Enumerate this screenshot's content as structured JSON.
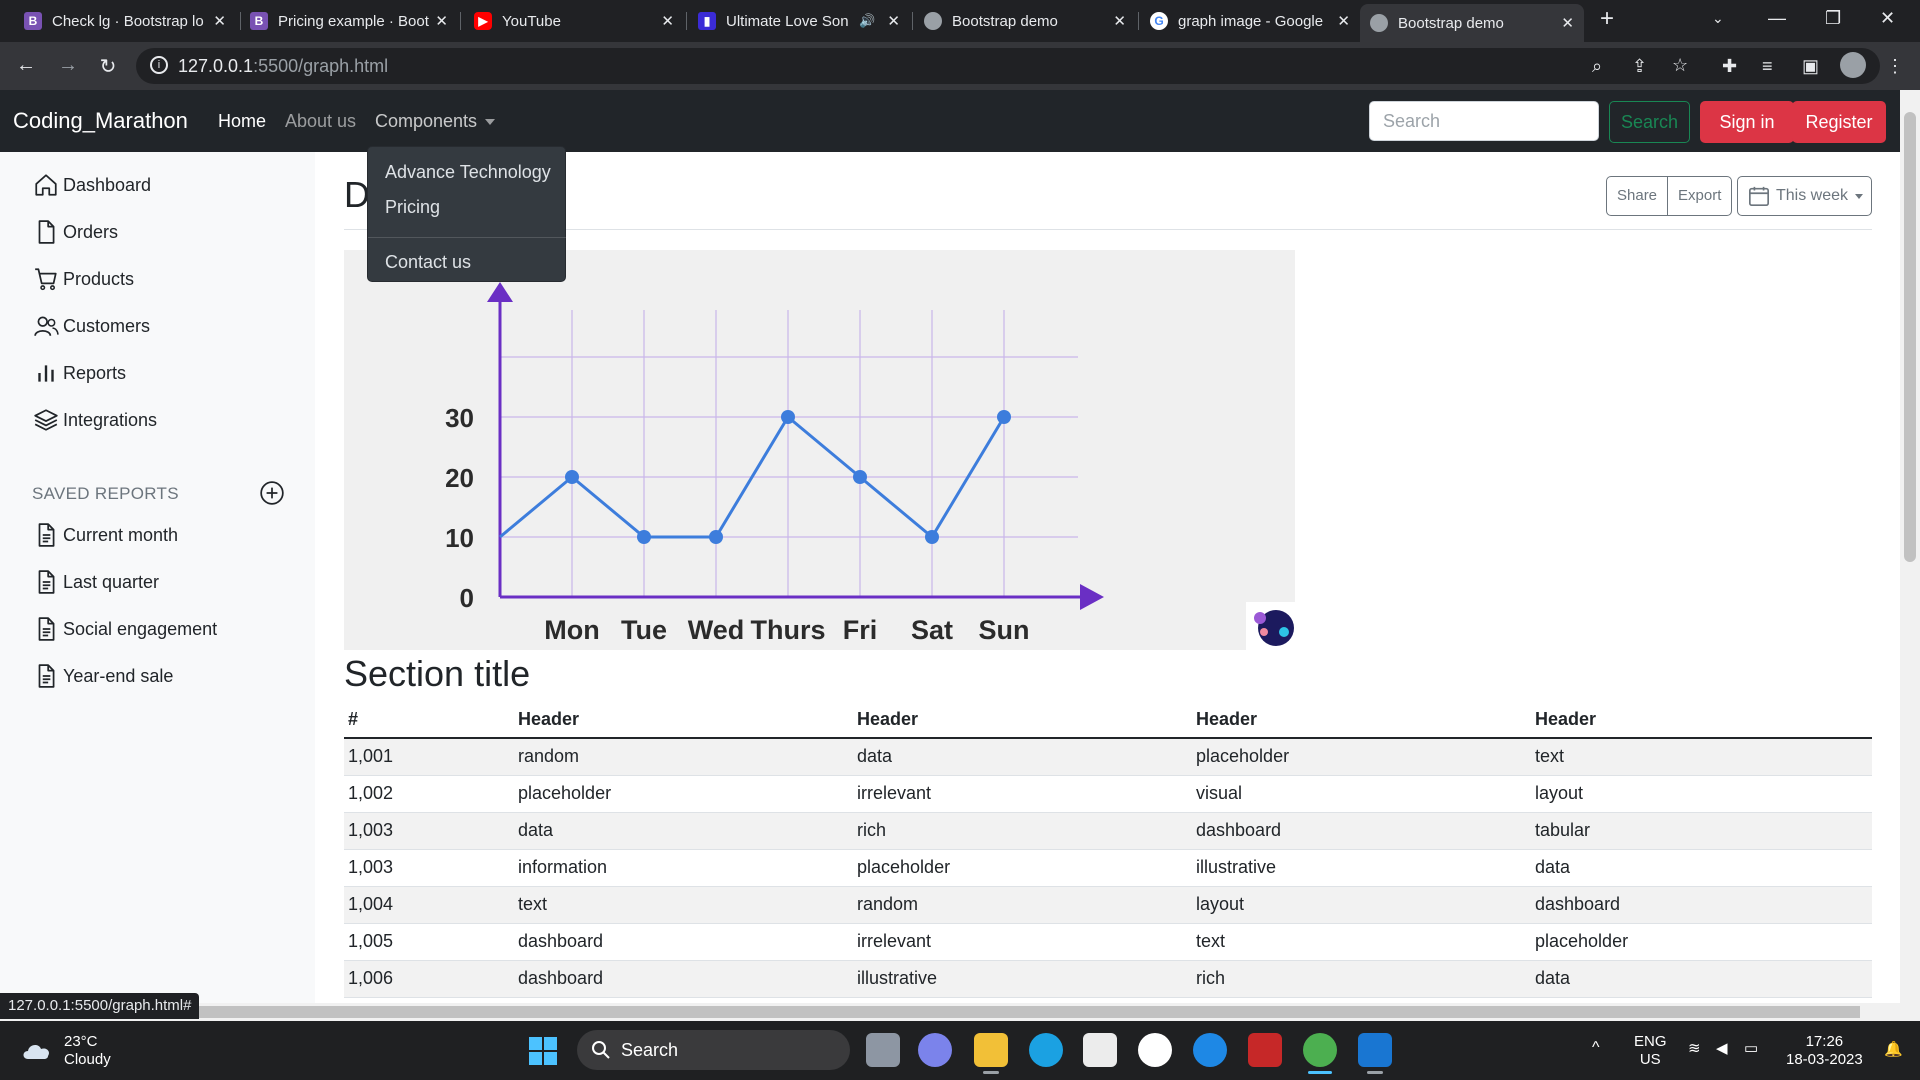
{
  "browser": {
    "tabs": [
      {
        "title": "Check lg · Bootstrap lo",
        "favicon": "bootstrap-icon"
      },
      {
        "title": "Pricing example · Boot",
        "favicon": "bootstrap-icon"
      },
      {
        "title": "YouTube",
        "favicon": "youtube-icon"
      },
      {
        "title": "Ultimate Love Son",
        "favicon": "music-icon"
      },
      {
        "title": "Bootstrap demo",
        "favicon": "globe-icon"
      },
      {
        "title": "graph image - Google",
        "favicon": "google-icon"
      },
      {
        "title": "Bootstrap demo",
        "favicon": "globe-icon",
        "active": true
      }
    ],
    "url_host": "127.0.0.1",
    "url_path": ":5500/graph.html",
    "status_url": "127.0.0.1:5500/graph.html#"
  },
  "navbar": {
    "brand": "Coding_Marathon",
    "links": [
      "Home",
      "About us",
      "Components"
    ],
    "search_placeholder": "Search",
    "search_button": "Search",
    "signin": "Sign in",
    "register": "Register",
    "dropdown": [
      "Advance Technology",
      "Pricing",
      "Contact us"
    ]
  },
  "sidebar": {
    "items": [
      {
        "label": "Dashboard",
        "icon": "house-icon"
      },
      {
        "label": "Orders",
        "icon": "file-icon"
      },
      {
        "label": "Products",
        "icon": "cart-icon"
      },
      {
        "label": "Customers",
        "icon": "people-icon"
      },
      {
        "label": "Reports",
        "icon": "bar-chart-icon"
      },
      {
        "label": "Integrations",
        "icon": "layers-icon"
      }
    ],
    "saved_heading": "SAVED REPORTS",
    "saved": [
      "Current month",
      "Last quarter",
      "Social engagement",
      "Year-end sale"
    ]
  },
  "main": {
    "title_visible": "D",
    "share": "Share",
    "export": "Export",
    "period": "This week",
    "section_title": "Section title"
  },
  "chart_data": {
    "type": "line",
    "categories": [
      "Mon",
      "Tue",
      "Wed",
      "Thurs",
      "Fri",
      "Sat",
      "Sun"
    ],
    "series": [
      {
        "values": [
          20,
          10,
          10,
          30,
          20,
          10,
          30
        ]
      }
    ],
    "start_value": 10,
    "yticks": [
      0,
      10,
      20,
      30
    ],
    "ylim": [
      0,
      40
    ],
    "grid": true,
    "line_color": "#3d7ddc",
    "axis_color": "#6a2fc4",
    "grid_color": "#c9b6ea"
  },
  "table": {
    "headers": [
      "#",
      "Header",
      "Header",
      "Header",
      "Header"
    ],
    "rows": [
      [
        "1,001",
        "random",
        "data",
        "placeholder",
        "text"
      ],
      [
        "1,002",
        "placeholder",
        "irrelevant",
        "visual",
        "layout"
      ],
      [
        "1,003",
        "data",
        "rich",
        "dashboard",
        "tabular"
      ],
      [
        "1,003",
        "information",
        "placeholder",
        "illustrative",
        "data"
      ],
      [
        "1,004",
        "text",
        "random",
        "layout",
        "dashboard"
      ],
      [
        "1,005",
        "dashboard",
        "irrelevant",
        "text",
        "placeholder"
      ],
      [
        "1,006",
        "dashboard",
        "illustrative",
        "rich",
        "data"
      ]
    ]
  },
  "taskbar": {
    "temperature": "23°C",
    "weather": "Cloudy",
    "search": "Search",
    "language": "ENG",
    "region": "US",
    "time": "17:26",
    "date": "18-03-2023"
  }
}
